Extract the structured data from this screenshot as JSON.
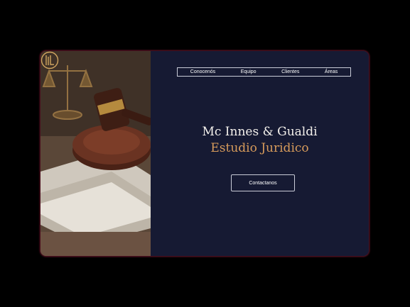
{
  "nav": {
    "items": [
      {
        "label": "Conocenós"
      },
      {
        "label": "Equipo"
      },
      {
        "label": "Clientes"
      },
      {
        "label": "Áreas"
      }
    ]
  },
  "hero": {
    "title_line1": "Mc Innes & Gualdi",
    "title_line2": "Estudio Juridico",
    "cta_label": "Contactanos"
  },
  "colors": {
    "panel": "#161a33",
    "accent_gold": "#d79b5b",
    "title_white": "#f4f1ec",
    "frame_glow": "#c82850"
  },
  "icons": {
    "logo": "law-firm-monogram-icon"
  }
}
